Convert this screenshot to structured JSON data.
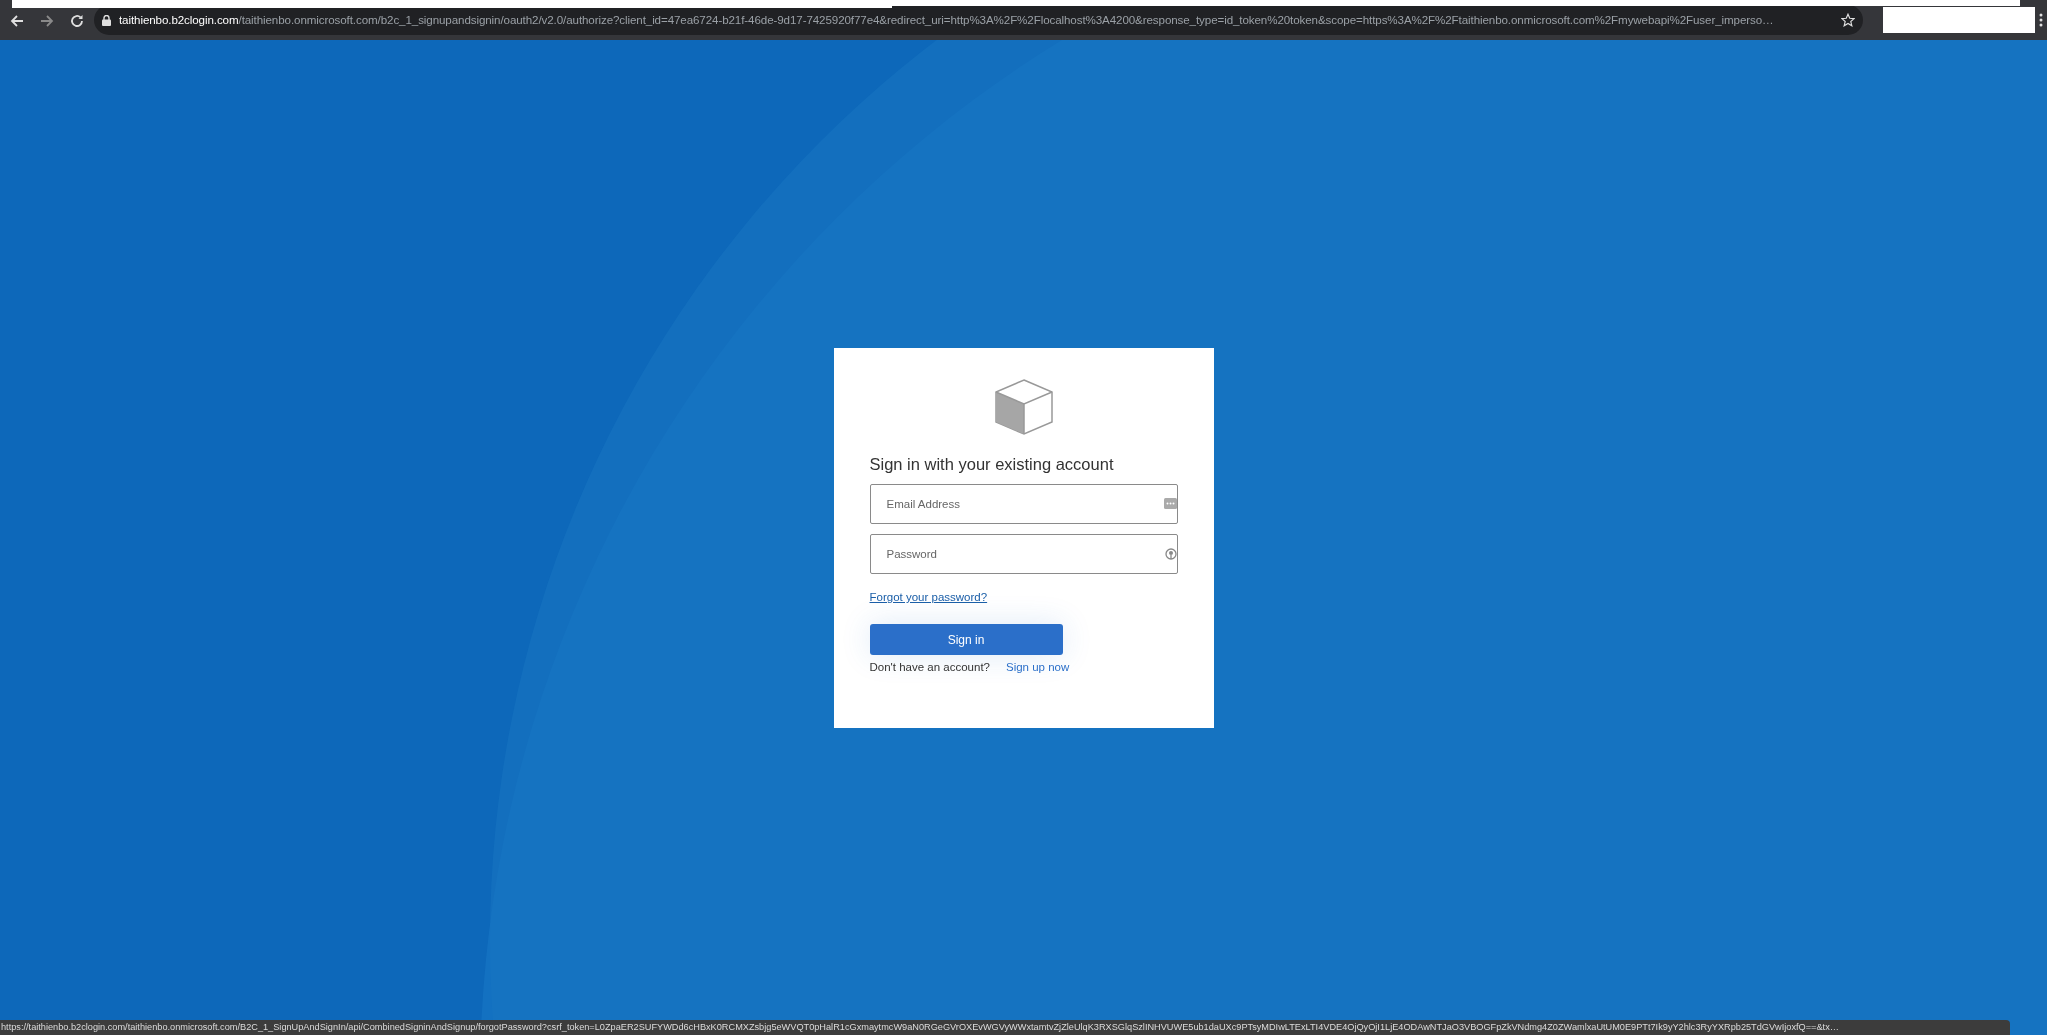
{
  "browser": {
    "url_domain": "taithienbo.b2clogin.com",
    "url_path": "/taithienbo.onmicrosoft.com/b2c_1_signupandsignin/oauth2/v2.0/authorize?client_id=47ea6724-b21f-46de-9d17-7425920f77e4&redirect_uri=http%3A%2F%2Flocalhost%3A4200&response_type=id_token%20token&scope=https%3A%2F%2Ftaithienbo.onmicrosoft.com%2Fmywebapi%2Fuser_imperso…"
  },
  "sign_in": {
    "heading": "Sign in with your existing account",
    "email_field": {
      "placeholder": "Email Address"
    },
    "password_field": {
      "placeholder": "Password"
    },
    "forgot_link": "Forgot your password?",
    "submit_button": "Sign in",
    "signup_prompt": "Don't have an account?",
    "signup_link": "Sign up now"
  },
  "status_bar": "https://taithienbo.b2clogin.com/taithienbo.onmicrosoft.com/B2C_1_SignUpAndSignIn/api/CombinedSigninAndSignup/forgotPassword?csrf_token=L0ZpaER2SUFYWDd6cHBxK0RCMXZsbjg5eWVQT0pHalR1cGxmaytmcW9aN0RGeGVrOXEvWGVyWWxtamtvZjZleUlqK3RXSGlqSzlINHVUWE5ub1daUXc9PTsyMDIwLTExLTI4VDE4OjQyOjI1LjE4ODAwNTJaO3VBOGFpZkVNdmg4Z0ZWamlxaUtUM0E9PTt7Ik9yY2hlc3RyYXRpb25TdGVwIjoxfQ==&tx…"
}
